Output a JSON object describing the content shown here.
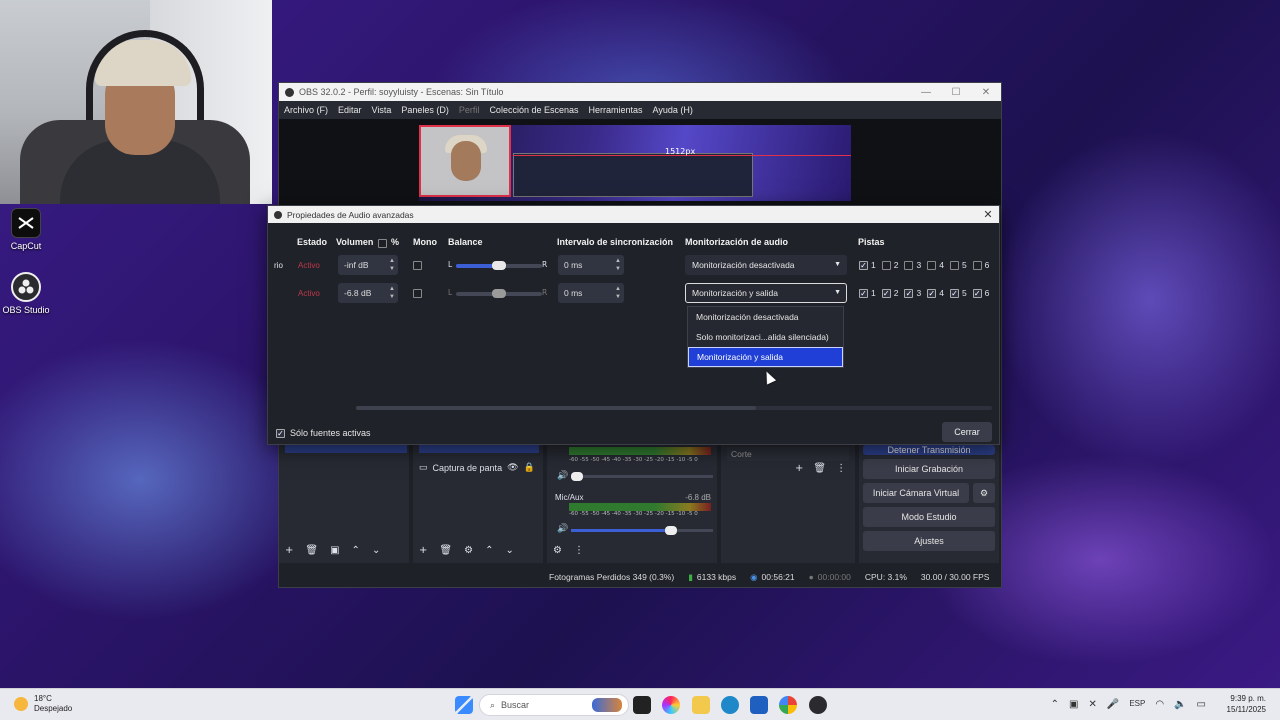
{
  "desktop": {
    "icons": [
      {
        "label": "CapCut",
        "icon": "capcut-icon"
      },
      {
        "label": "OBS Studio",
        "icon": "obs-icon"
      }
    ]
  },
  "obs": {
    "title": "OBS 32.0.2 - Perfil: soyyluisty - Escenas: Sin Título",
    "menu": [
      "Archivo (F)",
      "Editar",
      "Vista",
      "Paneles (D)",
      "Perfil",
      "Colección de Escenas",
      "Herramientas",
      "Ayuda (H)"
    ],
    "preview_label": "1512px",
    "sources": {
      "item": "Captura de panta"
    },
    "mixer": {
      "meter_scale": "-60 -55 -50 -45 -40 -35 -30 -25 -20 -15 -10 -5 0",
      "mic_label": "Mic/Aux",
      "mic_db": "-6.8 dB"
    },
    "transition": "Corte",
    "controls": [
      "Detener Transmisión",
      "Iniciar Grabación",
      "Iniciar Cámara Virtual",
      "Modo Estudio",
      "Ajustes"
    ],
    "status": {
      "frames": "Fotogramas Perdidos 349 (0.3%)",
      "bitrate": "6133 kbps",
      "stream_time": "00:56:21",
      "rec_time": "00:00:00",
      "cpu": "CPU: 3.1%",
      "fps": "30.00 / 30.00 FPS"
    }
  },
  "dialog": {
    "title": "Propiedades de Audio avanzadas",
    "headers": {
      "status": "Estado",
      "volume": "Volumen",
      "percent": "%",
      "mono": "Mono",
      "balance": "Balance",
      "sync": "Intervalo de sincronización",
      "monitoring": "Monitorización de audio",
      "tracks": "Pistas"
    },
    "rows": [
      {
        "name_partial": "rio",
        "status": "Activo",
        "volume": "-inf dB",
        "balance_left": "L",
        "balance_right": "R",
        "balance": 0.5,
        "sync": "0 ms",
        "monitoring": "Monitorización desactivada",
        "tracks": [
          true,
          false,
          false,
          false,
          false,
          false
        ]
      },
      {
        "name_partial": "",
        "status": "Activo",
        "volume": "-6.8 dB",
        "balance_left": "L",
        "balance_right": "R",
        "balance": 0.5,
        "sync": "0 ms",
        "monitoring": "Monitorización y salida",
        "tracks": [
          true,
          true,
          true,
          true,
          true,
          true
        ]
      }
    ],
    "track_numbers": [
      "1",
      "2",
      "3",
      "4",
      "5",
      "6"
    ],
    "dropdown_options": [
      "Monitorización desactivada",
      "Solo monitorizaci...alida silenciada)",
      "Monitorización y salida"
    ],
    "dropdown_selected_index": 2,
    "active_only_label": "Sólo fuentes activas",
    "active_only_checked": true,
    "close_label": "Cerrar"
  },
  "taskbar": {
    "weather_temp": "18°C",
    "weather_desc": "Despejado",
    "search_placeholder": "Buscar",
    "language": "ESP",
    "time": "9:39 p. m.",
    "date": "15/11/2025"
  }
}
